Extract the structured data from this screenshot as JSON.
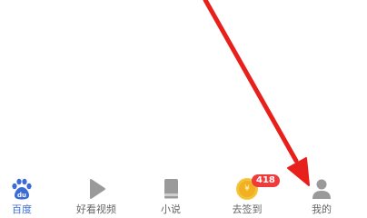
{
  "tabbar": {
    "items": [
      {
        "label": "百度",
        "icon": "baidu-paw-icon",
        "active": true
      },
      {
        "label": "好看视频",
        "icon": "play-icon",
        "active": false
      },
      {
        "label": "小说",
        "icon": "book-icon",
        "active": false
      },
      {
        "label": "去签到",
        "icon": "coin-icon",
        "active": false,
        "badge": "418",
        "icon_text": "¥"
      },
      {
        "label": "我的",
        "icon": "person-icon",
        "active": false
      }
    ]
  },
  "colors": {
    "active": "#3b6bd6",
    "inactive_icon": "#9a9a9a",
    "label": "#666666",
    "badge": "#ef3b3b",
    "coin": "#f5c33b",
    "arrow": "#e8201c"
  }
}
